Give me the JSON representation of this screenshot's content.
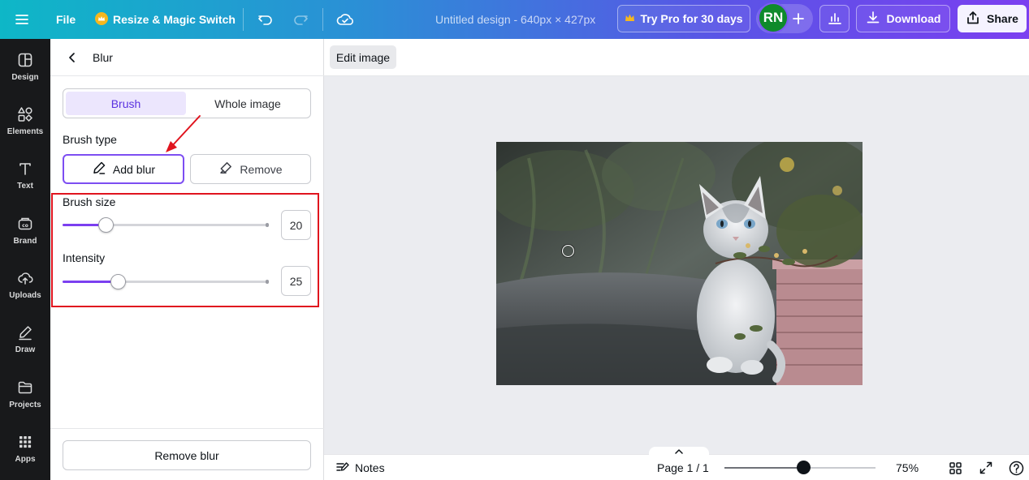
{
  "topbar": {
    "file_label": "File",
    "resize_label": "Resize & Magic Switch",
    "title": "Untitled design - 640px × 427px",
    "try_pro_label": "Try Pro for 30 days",
    "avatar_initials": "RN",
    "download_label": "Download",
    "share_label": "Share"
  },
  "rail": {
    "items": [
      {
        "label": "Design",
        "icon": "layout-icon"
      },
      {
        "label": "Elements",
        "icon": "shapes-icon"
      },
      {
        "label": "Text",
        "icon": "text-icon"
      },
      {
        "label": "Brand",
        "icon": "brand-icon"
      },
      {
        "label": "Uploads",
        "icon": "cloud-upload-icon"
      },
      {
        "label": "Draw",
        "icon": "pen-icon"
      },
      {
        "label": "Projects",
        "icon": "folder-icon"
      },
      {
        "label": "Apps",
        "icon": "grid-icon"
      }
    ]
  },
  "panel": {
    "title": "Blur",
    "segment": {
      "brush_label": "Brush",
      "whole_label": "Whole image"
    },
    "brush_type_label": "Brush type",
    "add_blur_label": "Add blur",
    "remove_label": "Remove",
    "brush_size_label": "Brush size",
    "brush_size_value": "20",
    "brush_size_fraction": 0.21,
    "intensity_label": "Intensity",
    "intensity_value": "25",
    "intensity_fraction": 0.27,
    "remove_blur_label": "Remove blur"
  },
  "canvas": {
    "edit_image_label": "Edit image"
  },
  "bottombar": {
    "notes_label": "Notes",
    "page_label": "Page 1 / 1",
    "zoom_label": "75%",
    "zoom_fraction": 0.52
  },
  "colors": {
    "accent": "#7b3ff0",
    "highlight": "#e0141e",
    "avatar": "#0f8a2b"
  }
}
